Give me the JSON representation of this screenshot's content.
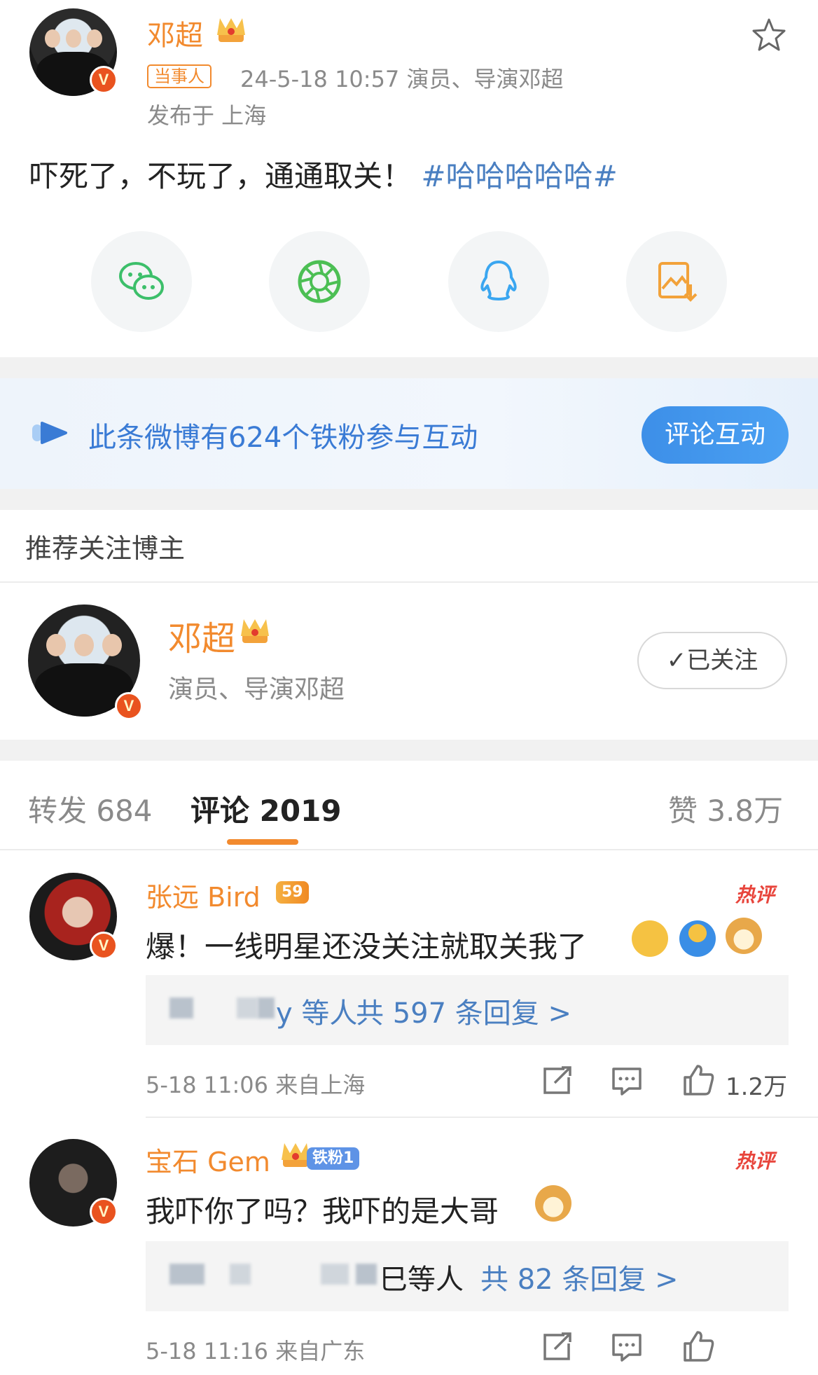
{
  "post": {
    "author": "邓超",
    "tag": "当事人",
    "meta": "24-5-18 10:57  演员、导演邓超",
    "location": "发布于 上海",
    "text_main": "吓死了，不玩了，通通取关！",
    "hashtag": "#哈哈哈哈哈#",
    "avatar_badge": "V"
  },
  "share": {
    "items": [
      {
        "icon": "wechat-icon"
      },
      {
        "icon": "moments-icon"
      },
      {
        "icon": "qq-icon"
      },
      {
        "icon": "save-image-icon"
      }
    ]
  },
  "fans_banner": {
    "text": "此条微博有624个铁粉参与互动",
    "button": "评论互动"
  },
  "recommend": {
    "title": "推荐关注博主",
    "name": "邓超",
    "desc": "演员、导演邓超",
    "follow_label": "✓已关注",
    "avatar_badge": "V"
  },
  "tabs": {
    "repost": "转发 684",
    "comment": "评论 2019",
    "like": "赞 3.8万"
  },
  "comments": [
    {
      "name": "张远 Bird",
      "level": "59",
      "hot": "热评",
      "text": "爆！一线明星还没关注就取关我了",
      "reply_who": "y 等人",
      "reply_count": "共 597 条回复 >",
      "time": "5-18 11:06  来自上海",
      "likes": "1.2万",
      "avatar_badge": "V"
    },
    {
      "name": "宝石 Gem",
      "level": "铁粉1",
      "hot": "热评",
      "text": "我吓你了吗？我吓的是大哥",
      "reply_who": "巳等人",
      "reply_count": "共 82 条回复 >",
      "time": "5-18 11:16  来自广东",
      "likes": "",
      "avatar_badge": "V"
    }
  ],
  "colors": {
    "accent_orange": "#f28a2e",
    "link_blue": "#4a7fc1",
    "fans_blue": "#3a7bd5",
    "hot_red": "#e8453c"
  }
}
